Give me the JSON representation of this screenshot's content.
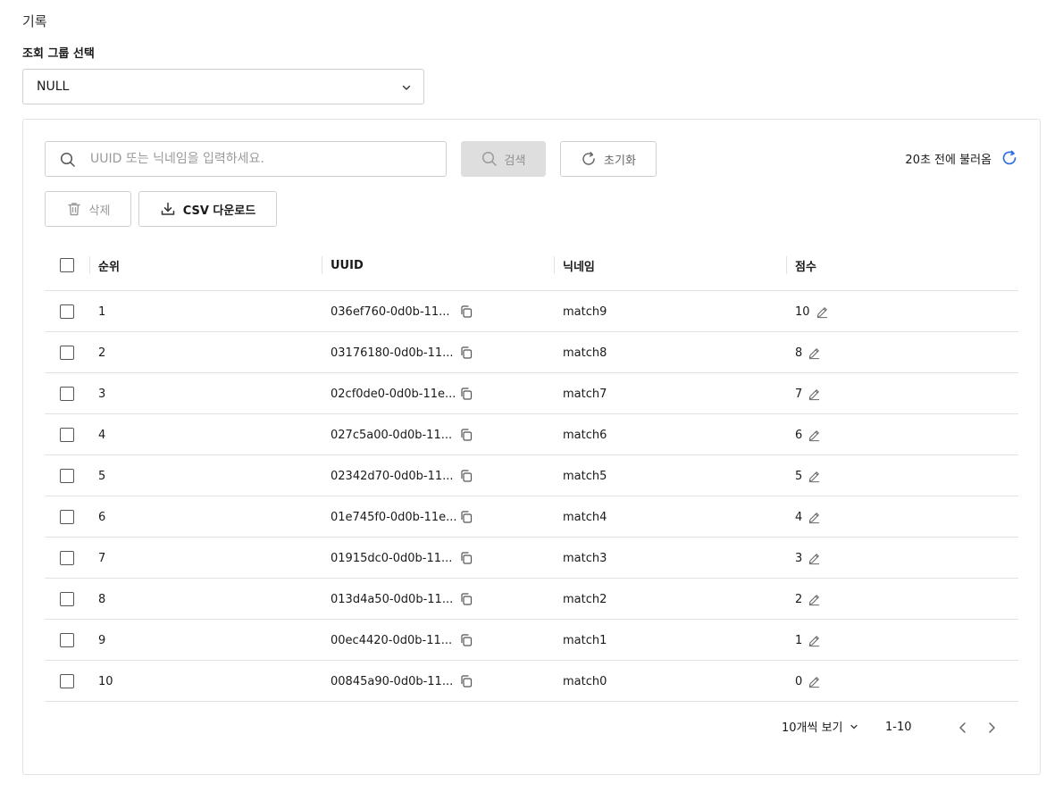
{
  "page": {
    "title": "기록"
  },
  "group": {
    "label": "조회 그룹 선택",
    "selected": "NULL"
  },
  "search": {
    "placeholder": "UUID 또는 닉네임을 입력하세요.",
    "value": "",
    "button_label": "검색",
    "reset_label": "초기화"
  },
  "status": {
    "loaded_text": "20초 전에 불러옴"
  },
  "actions": {
    "delete_label": "삭제",
    "csv_label": "CSV 다운로드"
  },
  "table": {
    "headers": {
      "rank": "순위",
      "uuid": "UUID",
      "nickname": "닉네임",
      "score": "점수"
    },
    "rows": [
      {
        "rank": "1",
        "uuid": "036ef760-0d0b-11...",
        "nickname": "match9",
        "score": "10"
      },
      {
        "rank": "2",
        "uuid": "03176180-0d0b-11...",
        "nickname": "match8",
        "score": "8"
      },
      {
        "rank": "3",
        "uuid": "02cf0de0-0d0b-11e...",
        "nickname": "match7",
        "score": "7"
      },
      {
        "rank": "4",
        "uuid": "027c5a00-0d0b-11...",
        "nickname": "match6",
        "score": "6"
      },
      {
        "rank": "5",
        "uuid": "02342d70-0d0b-11...",
        "nickname": "match5",
        "score": "5"
      },
      {
        "rank": "6",
        "uuid": "01e745f0-0d0b-11e...",
        "nickname": "match4",
        "score": "4"
      },
      {
        "rank": "7",
        "uuid": "01915dc0-0d0b-11...",
        "nickname": "match3",
        "score": "3"
      },
      {
        "rank": "8",
        "uuid": "013d4a50-0d0b-11...",
        "nickname": "match2",
        "score": "2"
      },
      {
        "rank": "9",
        "uuid": "00ec4420-0d0b-11...",
        "nickname": "match1",
        "score": "1"
      },
      {
        "rank": "10",
        "uuid": "00845a90-0d0b-11...",
        "nickname": "match0",
        "score": "0"
      }
    ]
  },
  "pagination": {
    "per_page_label": "10개씩 보기",
    "range": "1-10"
  },
  "icons": {
    "dropdown": "chevron-down-icon",
    "search": "search-icon",
    "reset": "refresh-icon",
    "reload": "refresh-icon",
    "delete": "trash-icon",
    "csv": "download-icon",
    "copy": "copy-icon",
    "edit": "pencil-icon",
    "prev": "chevron-left-icon",
    "next": "chevron-right-icon"
  },
  "colors": {
    "accent": "#2f6fe4",
    "disabled_bg": "#dedede",
    "border": "#cfcfcf"
  }
}
